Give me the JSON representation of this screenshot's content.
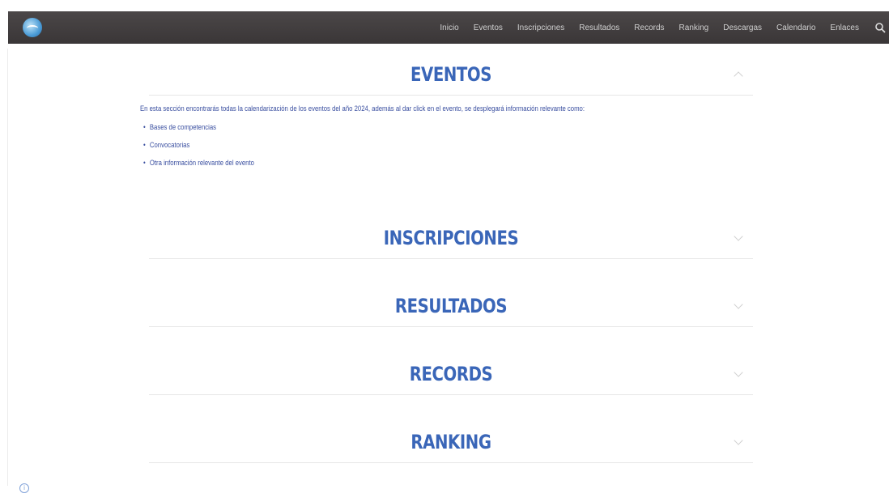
{
  "header": {
    "nav": [
      "Inicio",
      "Eventos",
      "Inscripciones",
      "Resultados",
      "Records",
      "Ranking",
      "Descargas",
      "Calendario",
      "Enlaces"
    ]
  },
  "sections": {
    "eventos": {
      "title": "EVENTOS",
      "intro": "En esta sección encontrarás todas la calendarización de los eventos del año 2024, además al dar click en el evento, se desplegará información relevante como:",
      "bullets": [
        "Bases de competencias",
        "Convocatorias",
        "Otra información relevante del evento"
      ]
    },
    "inscripciones": {
      "title": "INSCRIPCIONES"
    },
    "resultados": {
      "title": "RESULTADOS"
    },
    "records": {
      "title": "RECORDS"
    },
    "ranking": {
      "title": "RANKING"
    }
  },
  "colors": {
    "accent": "#3a66b8",
    "topbar": "#413d3e",
    "text": "#3a4fa0"
  }
}
